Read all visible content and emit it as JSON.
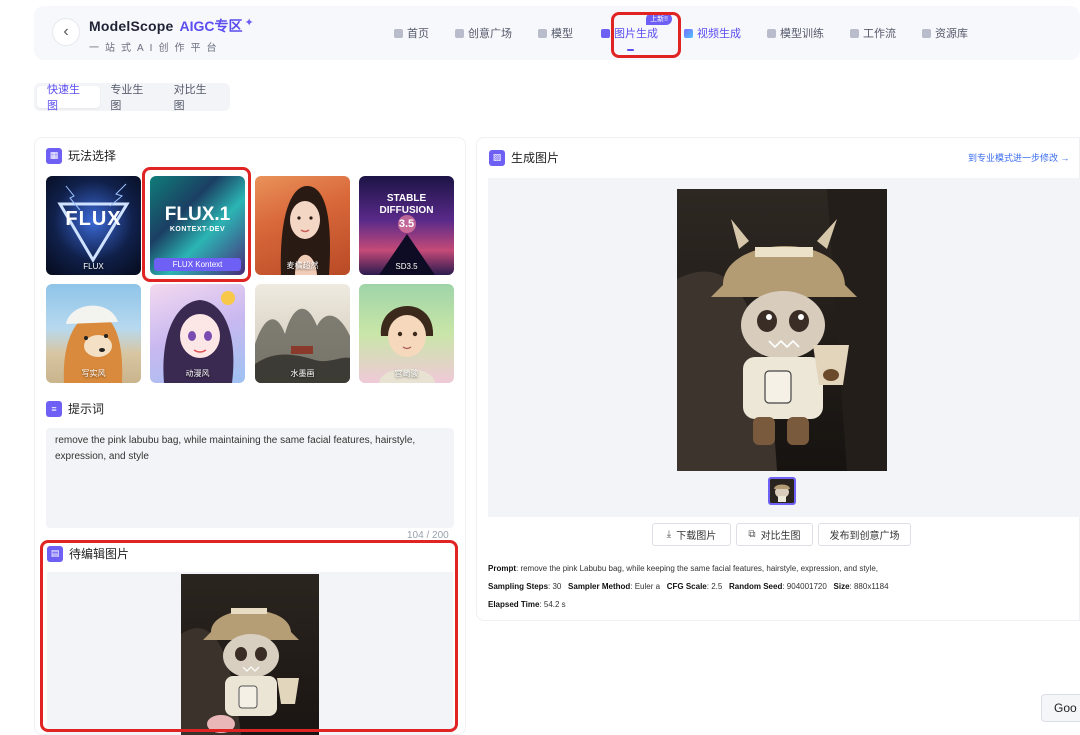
{
  "header": {
    "back_icon": "chevron-left-icon",
    "brand": "ModelScope",
    "brand_accent": "AIGC专区",
    "brand_star": "✦",
    "tagline": "一站式AI创作平台",
    "nav": [
      {
        "label": "首页",
        "icon": "home-icon"
      },
      {
        "label": "创意广场",
        "icon": "brush-icon"
      },
      {
        "label": "模型",
        "icon": "cube-icon"
      },
      {
        "label": "图片生成",
        "icon": "image-icon",
        "active": true,
        "badge": "上新!!"
      },
      {
        "label": "视频生成",
        "icon": "video-icon"
      },
      {
        "label": "模型训练",
        "icon": "train-icon"
      },
      {
        "label": "工作流",
        "icon": "workflow-icon"
      },
      {
        "label": "资源库",
        "icon": "library-icon"
      }
    ]
  },
  "mode_tabs": [
    {
      "label": "快速生图",
      "active": true
    },
    {
      "label": "专业生图"
    },
    {
      "label": "对比生图"
    }
  ],
  "styles_section": {
    "title": "玩法选择",
    "cards": [
      {
        "label": "FLUX",
        "big": "FLUX"
      },
      {
        "label": "FLUX Kontext",
        "big": "FLUX.1",
        "big_sub": "KONTEXT-DEV",
        "selected": true
      },
      {
        "label": "麦橘超然"
      },
      {
        "label": "SD3.5",
        "big": "STABLE DIFFUSION",
        "big_sub": "3.5"
      },
      {
        "label": "写实风"
      },
      {
        "label": "动漫风"
      },
      {
        "label": "水墨画"
      },
      {
        "label": "宫崎骏"
      }
    ]
  },
  "prompt_section": {
    "title": "提示词",
    "text": "remove the pink labubu bag, while maintaining the same facial features, hairstyle, expression, and style",
    "count": "104 / 200"
  },
  "edit_section": {
    "title": "待编辑图片"
  },
  "result_section": {
    "title": "生成图片",
    "pro_link": "到专业模式进一步修改 →",
    "buttons": {
      "download": "下载图片",
      "compare": "对比生图",
      "publish": "发布到创意广场"
    },
    "meta": {
      "prompt_label": "Prompt",
      "prompt": ": remove the pink Labubu bag, while keeping the same facial features, hairstyle, expression, and style,",
      "steps_label": "Sampling Steps",
      "steps": ": 30",
      "sampler_label": "Sampler Method",
      "sampler": ": Euler a",
      "cfg_label": "CFG Scale",
      "cfg": ": 2.5",
      "seed_label": "Random Seed",
      "seed": ": 904001720",
      "size_label": "Size",
      "size": ": 880x1184",
      "time_label": "Elapsed Time",
      "time": ": 54.2 s"
    }
  },
  "goo": "Goo",
  "colors": {
    "accent": "#5b4df0",
    "highlight": "#e02424"
  }
}
